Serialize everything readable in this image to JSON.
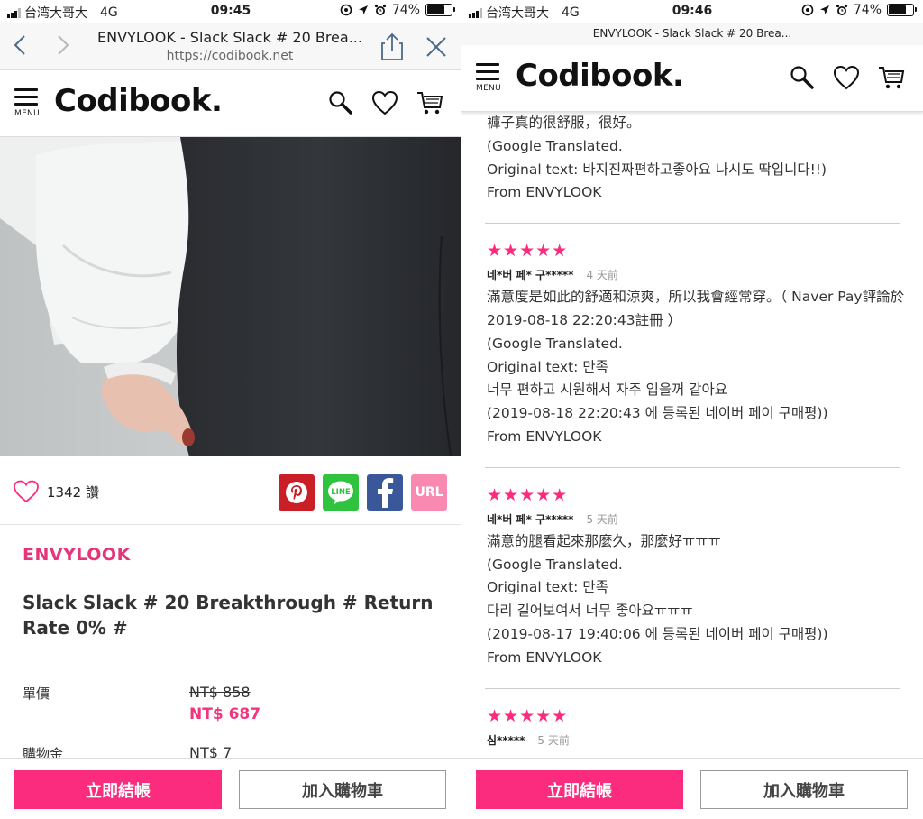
{
  "left": {
    "status": {
      "carrier": "台湾大哥大",
      "network": "4G",
      "time": "09:45",
      "battery": "74%",
      "battery_level": 0.74
    },
    "browser": {
      "title": "ENVYLOOK - Slack Slack # 20 Brea...",
      "url": "https://codibook.net"
    },
    "header": {
      "logo": "Codibook.",
      "menu_label": "MENU"
    },
    "social": {
      "like_count": "1342 讚",
      "url_label": "URL"
    },
    "product": {
      "brand": "ENVYLOOK",
      "title": "Slack Slack # 20 Breakthrough # Return Rate 0% #",
      "price_label": "單價",
      "old_price": "NT$ 858",
      "new_price": "NT$ 687",
      "points_label": "購物金",
      "points_value": "NT$ 7"
    },
    "actions": {
      "checkout": "立即結帳",
      "add_to_cart": "加入購物車"
    }
  },
  "right": {
    "status": {
      "carrier": "台湾大哥大",
      "network": "4G",
      "time": "09:46",
      "battery": "74%",
      "battery_level": 0.74
    },
    "browser": {
      "title": "ENVYLOOK - Slack Slack # 20 Brea..."
    },
    "header": {
      "logo": "Codibook.",
      "menu_label": "MENU"
    },
    "top_review_lines": [
      "褲子真的很舒服，很好。",
      "(Google Translated.",
      "Original text: 바지진짜편하고좋아요 나시도 딱입니다!!)",
      "From ENVYLOOK"
    ],
    "reviews": [
      {
        "stars": "★★★★★",
        "user": "네*버 페* 구*****",
        "date": "4 天前",
        "lines": [
          "滿意度是如此的舒適和涼爽，所以我會經常穿。（ Naver Pay評論於",
          "2019-08-18 22:20:43註冊 ）",
          "(Google Translated.",
          "Original text: 만족",
          "너무 편하고 시원해서 자주 입을꺼 같아요",
          "(2019-08-18 22:20:43 에 등록된 네이버 페이 구매평))",
          "From ENVYLOOK"
        ]
      },
      {
        "stars": "★★★★★",
        "user": "네*버 페* 구*****",
        "date": "5 天前",
        "lines": [
          "滿意的腿看起來那麼久，那麼好ㅠㅠㅠ",
          "(Google Translated.",
          "Original text: 만족",
          "다리 길어보여서 너무 좋아요ㅠㅠㅠ",
          "(2019-08-17 19:40:06 에 등록된 네이버 페이 구매평))",
          "From ENVYLOOK"
        ]
      },
      {
        "stars": "★★★★★",
        "user": "심*****",
        "date": "5 天前",
        "lines": []
      }
    ],
    "actions": {
      "checkout": "立即結帳",
      "add_to_cart": "加入購物車"
    }
  },
  "colors": {
    "accent": "#fb2c7d",
    "brand_pink": "#e5357a",
    "pinterest": "#cb1f27",
    "line": "#2fc33f",
    "facebook": "#3a5899",
    "url_btn": "#f989b0"
  },
  "icons": [
    "signal-icon",
    "location-icon",
    "alarm-icon",
    "battery-icon",
    "back-icon",
    "forward-icon",
    "share-icon",
    "close-icon",
    "menu-icon",
    "search-icon",
    "heart-icon",
    "cart-icon",
    "pinterest-icon",
    "line-icon",
    "facebook-icon"
  ]
}
